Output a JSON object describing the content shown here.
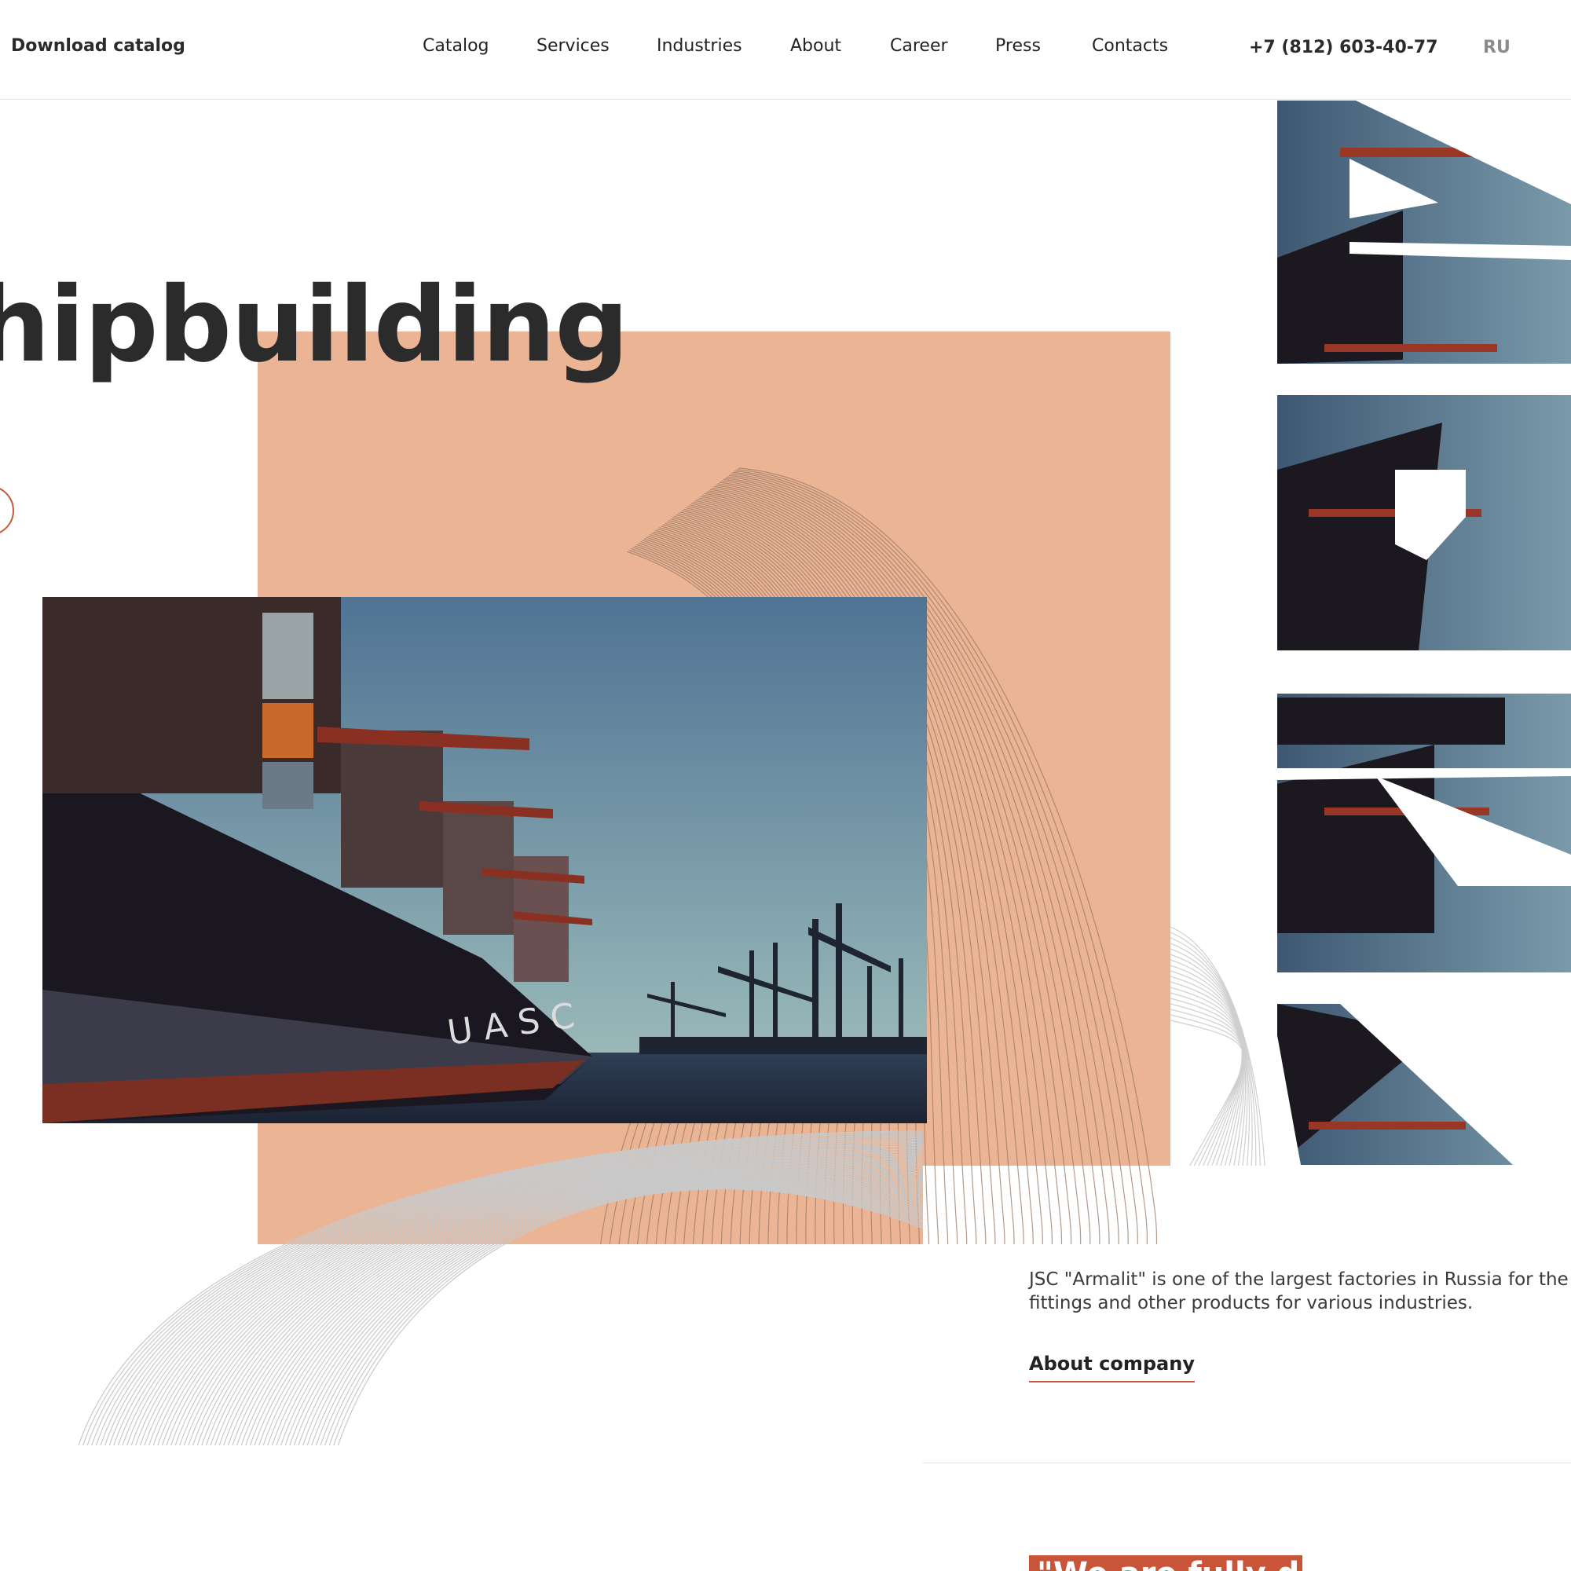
{
  "header": {
    "download_label": "Download catalog",
    "nav": [
      "Catalog",
      "Services",
      "Industries",
      "About",
      "Career",
      "Press",
      "Contacts"
    ],
    "phone": "+7 (812) 603-40-77",
    "lang": "RU"
  },
  "hero": {
    "title": "hipbuilding",
    "photo_alt": "Container ship at port with cranes"
  },
  "about": {
    "text_line1": "JSC \"Armalit\" is one of the largest factories in Russia for the pro",
    "text_line2": "fittings and other products for various industries.",
    "link": "About company"
  },
  "quote": {
    "text": "\"We are fully d"
  },
  "colors": {
    "peach": "#ebb494",
    "accent": "#c8553a",
    "text": "#2b2b2b",
    "muted": "#8b8b8b"
  },
  "icons": [
    "circle-button-icon"
  ]
}
